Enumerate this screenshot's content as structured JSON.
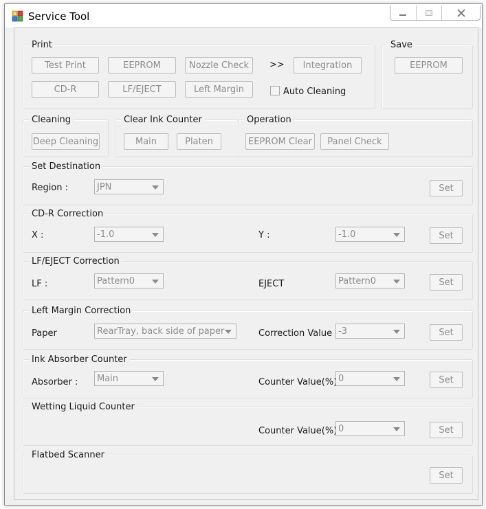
{
  "window": {
    "title": "Service Tool",
    "icon": "printer-app-icon"
  },
  "print": {
    "title": "Print",
    "test_print": "Test Print",
    "eeprom": "EEPROM",
    "nozzle_check": "Nozzle Check",
    "arrows": ">>",
    "integration": "Integration",
    "cd_r": "CD-R",
    "lf_eject": "LF/EJECT",
    "left_margin": "Left Margin",
    "auto_cleaning": "Auto Cleaning"
  },
  "save": {
    "title": "Save",
    "eeprom": "EEPROM"
  },
  "cleaning": {
    "title": "Cleaning",
    "deep_cleaning": "Deep Cleaning"
  },
  "clear_ink_counter": {
    "title": "Clear Ink Counter",
    "main": "Main",
    "platen": "Platen"
  },
  "operation": {
    "title": "Operation",
    "eeprom_clear": "EEPROM Clear",
    "panel_check": "Panel Check"
  },
  "set_destination": {
    "title": "Set Destination",
    "region_label": "Region :",
    "region_value": "JPN",
    "set": "Set"
  },
  "cdr_correction": {
    "title": "CD-R Correction",
    "x_label": "X :",
    "x_value": "-1.0",
    "y_label": "Y :",
    "y_value": "-1.0",
    "set": "Set"
  },
  "lf_eject_correction": {
    "title": "LF/EJECT Correction",
    "lf_label": "LF :",
    "lf_value": "Pattern0",
    "eject_label": "EJECT",
    "eject_value": "Pattern0",
    "set": "Set"
  },
  "left_margin_correction": {
    "title": "Left Margin Correction",
    "paper_label": "Paper",
    "paper_value": "RearTray, back side of paper",
    "correction_label": "Correction Value",
    "correction_value": "-3",
    "set": "Set"
  },
  "ink_absorber_counter": {
    "title": "Ink Absorber Counter",
    "absorber_label": "Absorber :",
    "absorber_value": "Main",
    "counter_label": "Counter Value(%)",
    "counter_value": "0",
    "set": "Set"
  },
  "wetting_liquid_counter": {
    "title": "Wetting Liquid Counter",
    "counter_label": "Counter Value(%)",
    "counter_value": "0",
    "set": "Set"
  },
  "flatbed_scanner": {
    "title": "Flatbed Scanner",
    "set": "Set"
  }
}
